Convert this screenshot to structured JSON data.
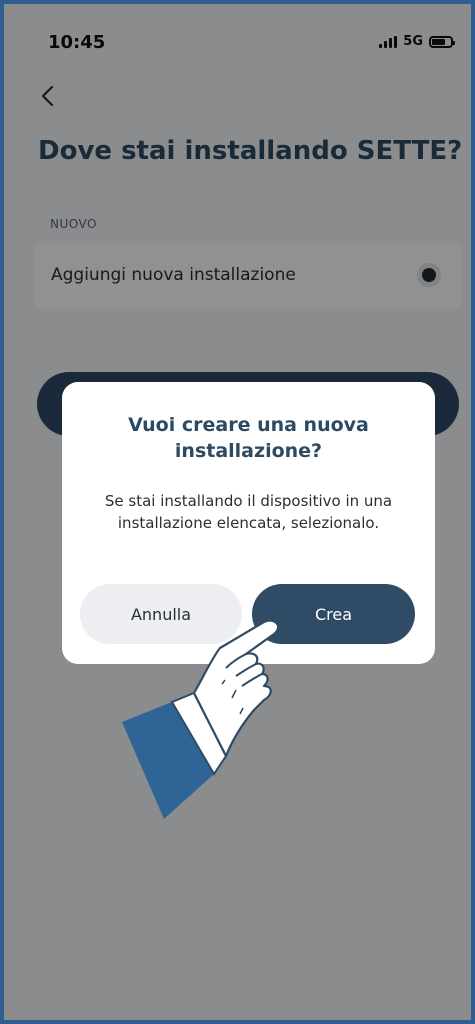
{
  "status_bar": {
    "time": "10:45",
    "network": "5G",
    "icons": [
      "signal-icon",
      "battery-icon"
    ]
  },
  "header": {
    "back_icon": "chevron-left-icon",
    "title": "Dove stai installando SETTE?"
  },
  "section": {
    "label": "NUOVO",
    "option": {
      "label": "Aggiungi nuova installazione",
      "selected": true
    }
  },
  "dialog": {
    "title": "Vuoi creare una nuova installazione?",
    "message": "Se stai installando il dispositivo in una installazione elencata, selezionalo.",
    "cancel_label": "Annulla",
    "confirm_label": "Crea"
  },
  "colors": {
    "frame": "#2f5f8e",
    "primary": "#2f4b66",
    "title": "#2d4a63",
    "overlay": "rgba(0,0,0,0.43)"
  }
}
